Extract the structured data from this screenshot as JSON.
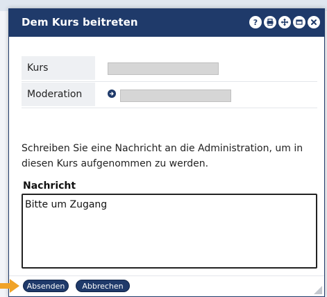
{
  "dialog": {
    "title": "Dem Kurs beitreten",
    "title_icons": [
      "help-icon",
      "print-icon",
      "move-icon",
      "minimize-icon",
      "close-icon"
    ]
  },
  "info": {
    "rows": [
      {
        "label": "Kurs"
      },
      {
        "label": "Moderation"
      }
    ]
  },
  "message": {
    "text": "Schreiben Sie eine Nachricht an die Administration, um in diesen Kurs aufgenommen zu werden.",
    "label": "Nachricht",
    "value": "Bitte um Zugang"
  },
  "buttons": {
    "send": "Absenden",
    "cancel": "Abbrechen"
  },
  "colors": {
    "primary": "#1f3a6a",
    "pointer": "#f0a328"
  }
}
